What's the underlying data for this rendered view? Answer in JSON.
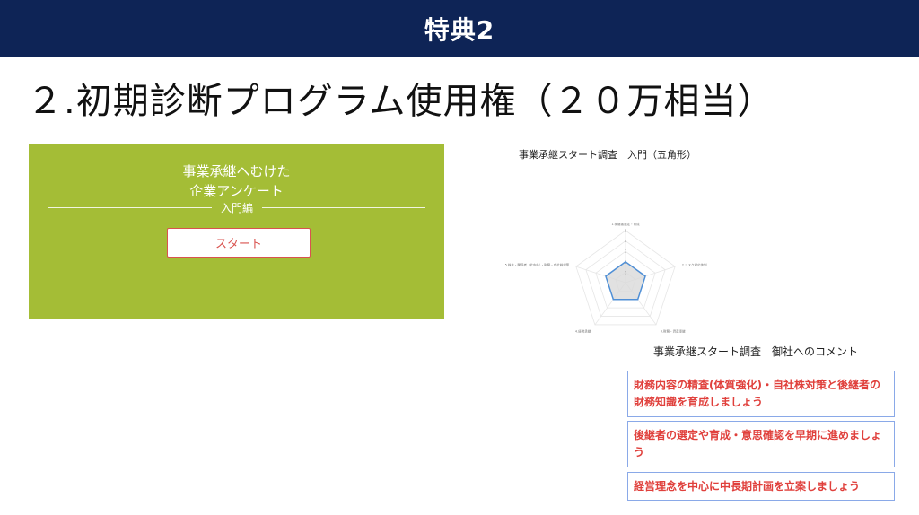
{
  "banner": {
    "title": "特典2"
  },
  "heading": "２.初期診断プログラム使用権（２０万相当）",
  "survey_card": {
    "title_line1": "事業承継へむけた",
    "title_line2": "企業アンケート",
    "subtitle": "入門編",
    "start_label": "スタート",
    "bg_color": "#a4bd36"
  },
  "chart_heading": "事業承継スタート調査　入門（五角形）",
  "chart_data": {
    "type": "radar",
    "title": "事業承継スタート調査　入門（五角形）",
    "axes": [
      "1.後継者選定・育成",
      "2.リスク対応体制",
      "3.財務・資産承継",
      "4.経営承継",
      "5.株主・関係者（社内外）・財務・自社株対策"
    ],
    "tick_labels": [
      "5",
      "4",
      "3",
      "2",
      "1"
    ],
    "rmax": 5,
    "values": [
      2,
      2,
      2,
      2,
      2
    ],
    "fill_color": "#d9d9d9",
    "line_color": "#4f8fd6"
  },
  "comments": {
    "heading": "事業承継スタート調査　御社へのコメント",
    "items": [
      "財務内容の精査(体質強化)・自社株対策と後継者の財務知識を育成しましょう",
      "後継者の選定や育成・意思確認を早期に進めましょう",
      "経営理念を中心に中長期計画を立案しましょう"
    ]
  }
}
